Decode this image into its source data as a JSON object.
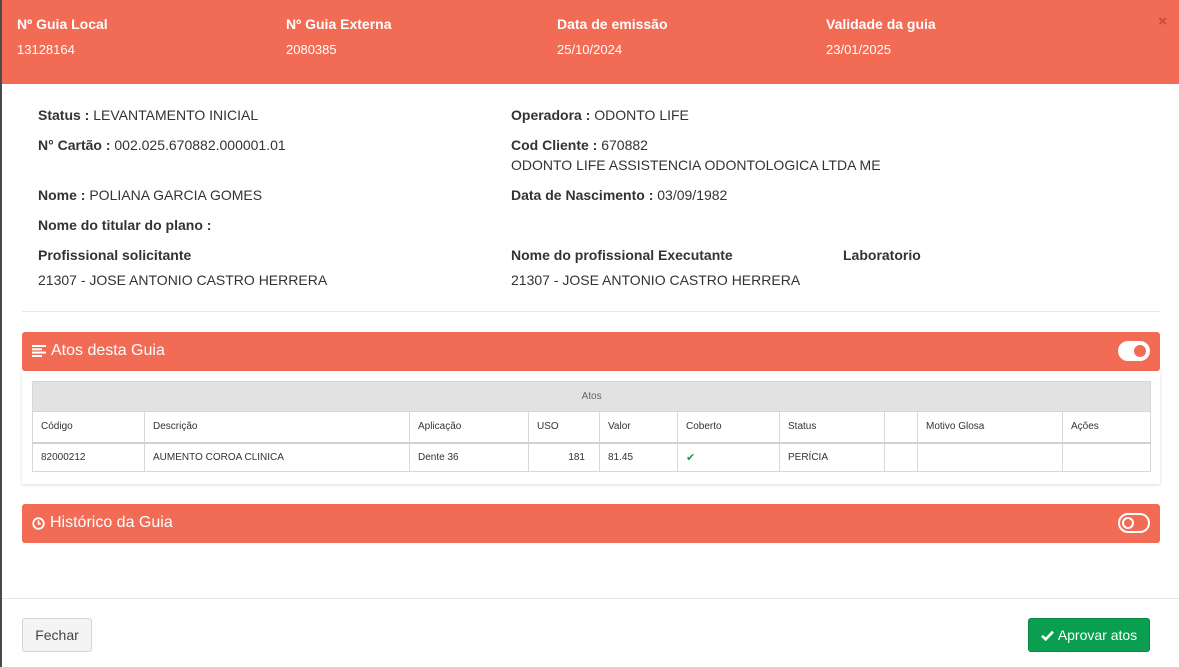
{
  "header": {
    "guia_local_label": "Nº Guia Local",
    "guia_local_value": "13128164",
    "guia_externa_label": "Nº Guia Externa",
    "guia_externa_value": "2080385",
    "data_emissao_label": "Data de emissão",
    "data_emissao_value": "25/10/2024",
    "validade_label": "Validade da guia",
    "validade_value": "23/01/2025",
    "close_glyph": "×"
  },
  "info": {
    "status_label": "Status :",
    "status_value": "LEVANTAMENTO INICIAL",
    "operadora_label": "Operadora :",
    "operadora_value": "ODONTO LIFE",
    "cartao_label": "N° Cartão :",
    "cartao_value": "002.025.670882.000001.01",
    "cod_cliente_label": "Cod Cliente :",
    "cod_cliente_value": "670882",
    "cliente_nome": "ODONTO LIFE ASSISTENCIA ODONTOLOGICA LTDA ME",
    "nome_label": "Nome :",
    "nome_value": "POLIANA GARCIA GOMES",
    "nascimento_label": "Data de Nascimento :",
    "nascimento_value": "03/09/1982",
    "titular_label": "Nome do titular do plano :",
    "prof_solicitante_label": "Profissional solicitante",
    "prof_solicitante_value": "21307 - JOSE ANTONIO CASTRO HERRERA",
    "prof_executante_label": "Nome do profissional Executante",
    "prof_executante_value": "21307 - JOSE ANTONIO CASTRO HERRERA",
    "laboratorio_label": "Laboratorio"
  },
  "atos_panel": {
    "title": "Atos desta Guia",
    "icon": "list-icon",
    "toggle_on": true,
    "group_header": "Atos",
    "columns": [
      "Código",
      "Descrição",
      "Aplicação",
      "USO",
      "Valor",
      "Coberto",
      "Status",
      "",
      "Motivo Glosa",
      "Ações"
    ],
    "rows": [
      {
        "codigo": "82000212",
        "descricao": "AUMENTO COROA CLINICA",
        "aplicacao": "Dente 36",
        "uso": "181",
        "valor": "81.45",
        "coberto_icon": "check-icon",
        "status": "PERÍCIA",
        "extra": "",
        "motivo_glosa": "",
        "acoes": ""
      }
    ]
  },
  "historico_panel": {
    "title": "Histórico da Guia",
    "icon": "clock-icon",
    "toggle_on": false
  },
  "footer": {
    "fechar_label": "Fechar",
    "aprovar_label": "Aprovar atos",
    "aprovar_icon": "check-icon"
  },
  "colors": {
    "accent": "#f26b55",
    "success": "#0a9f50"
  }
}
